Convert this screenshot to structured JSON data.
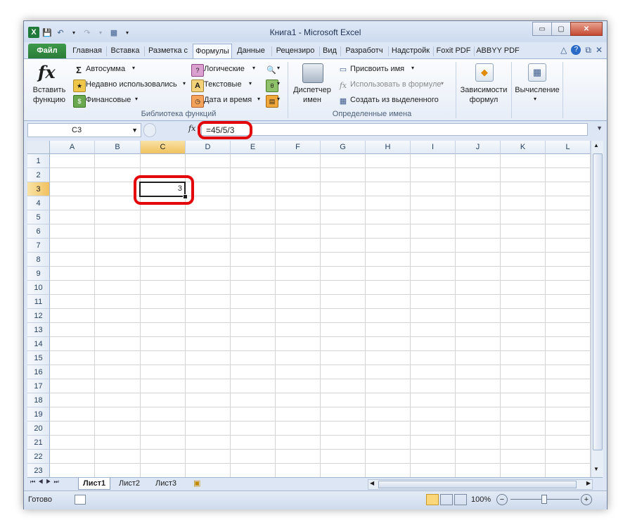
{
  "window": {
    "title": "Книга1  -  Microsoft Excel",
    "buttons": {
      "minimize": "▭",
      "maximize": "▢",
      "close": "✕"
    }
  },
  "tabs": [
    "Файл",
    "Главная",
    "Вставка",
    "Разметка с",
    "Формулы",
    "Данные",
    "Рецензиро",
    "Вид",
    "Разработч",
    "Надстройк",
    "Foxit PDF",
    "ABBYY PDF"
  ],
  "ribbon": {
    "insert_function": {
      "icon": "fx",
      "line1": "Вставить",
      "line2": "функцию"
    },
    "autosum": "Автосумма",
    "recent": "Недавно использовались",
    "financial": "Финансовые",
    "logical": "Логические",
    "text": "Текстовые",
    "datetime": "Дата и время",
    "group_library": "Библиотека функций",
    "name_manager": {
      "line1": "Диспетчер",
      "line2": "имен"
    },
    "define_name": "Присвоить имя",
    "use_in_formula": "Использовать в формуле",
    "create_from_selection": "Создать из выделенного",
    "group_names": "Определенные имена",
    "dependencies": {
      "line1": "Зависимости",
      "line2": "формул"
    },
    "calculation": {
      "line1": "Вычисление"
    }
  },
  "formula_bar": {
    "name_box": "C3",
    "fx": "fx",
    "formula": "=45/5/3"
  },
  "grid": {
    "columns": [
      "A",
      "B",
      "C",
      "D",
      "E",
      "F",
      "G",
      "H",
      "I",
      "J",
      "K",
      "L"
    ],
    "rows": [
      "1",
      "2",
      "3",
      "4",
      "5",
      "6",
      "7",
      "8",
      "9",
      "10",
      "11",
      "12",
      "13",
      "14",
      "15",
      "16",
      "17",
      "18",
      "19",
      "20",
      "21",
      "22",
      "23"
    ],
    "selected_cell": {
      "column": "C",
      "row": "3",
      "value": "3"
    }
  },
  "sheets": [
    "Лист1",
    "Лист2",
    "Лист3"
  ],
  "status": {
    "ready": "Готово",
    "zoom": "100%"
  }
}
